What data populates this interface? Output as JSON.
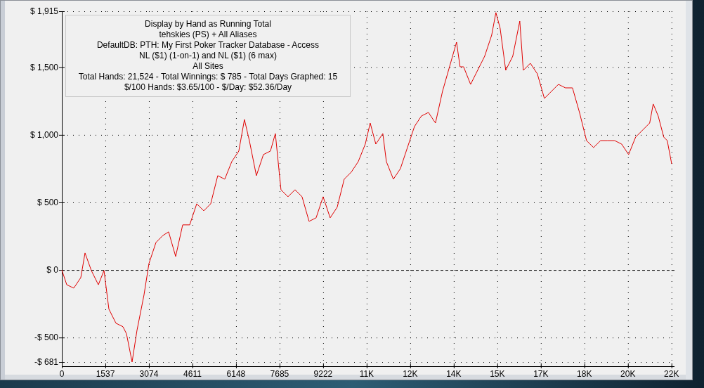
{
  "graph": {
    "legend_lines": [
      "Display by Hand as Running Total",
      "tehskies (PS) + All Aliases",
      "DefaultDB: PTH: My First Poker Tracker Database - Access",
      "NL ($1) (1-on-1) and NL ($1) (6 max)",
      "All Sites",
      "Total Hands: 21,524 - Total Winnings: $ 785 - Total Days Graphed: 15",
      "$/100 Hands: $3.65/100 - $/Day: $52.36/Day"
    ],
    "chart_data": {
      "type": "line",
      "x": [
        0,
        174,
        421,
        669,
        818,
        1041,
        1289,
        1487,
        1661,
        1909,
        2157,
        2281,
        2479,
        2653,
        2900,
        3074,
        3322,
        3570,
        3768,
        4016,
        4264,
        4512,
        4760,
        5008,
        5255,
        5503,
        5751,
        5999,
        6247,
        6445,
        6619,
        6867,
        7115,
        7363,
        7536,
        7734,
        7982,
        8230,
        8478,
        8726,
        8974,
        9222,
        9470,
        9718,
        9966,
        10213,
        10461,
        10709,
        10883,
        11081,
        11329,
        11453,
        11701,
        11949,
        12197,
        12445,
        12692,
        12940,
        13188,
        13436,
        13684,
        13932,
        14056,
        14180,
        14428,
        14676,
        14924,
        15171,
        15320,
        15469,
        15667,
        15915,
        16163,
        16287,
        16535,
        16783,
        17031,
        17279,
        17526,
        17774,
        18022,
        18270,
        18518,
        18766,
        19014,
        19262,
        19510,
        19758,
        20005,
        20253,
        20501,
        20749,
        20873,
        21047,
        21245,
        21369,
        21524
      ],
      "series": [
        {
          "color": "#e00000",
          "values": [
            0,
            -109,
            -134,
            -56,
            126,
            -4,
            -109,
            -4,
            -290,
            -394,
            -420,
            -472,
            -681,
            -446,
            -186,
            48,
            204,
            256,
            282,
            100,
            334,
            334,
            490,
            438,
            490,
            698,
            672,
            802,
            880,
            1114,
            958,
            698,
            854,
            880,
            1010,
            594,
            542,
            594,
            542,
            360,
            386,
            542,
            386,
            464,
            672,
            724,
            802,
            932,
            1088,
            932,
            1010,
            802,
            672,
            750,
            906,
            1062,
            1140,
            1166,
            1088,
            1322,
            1504,
            1686,
            1504,
            1504,
            1374,
            1478,
            1582,
            1738,
            1905,
            1790,
            1478,
            1582,
            1842,
            1478,
            1530,
            1452,
            1270,
            1322,
            1374,
            1348,
            1348,
            1166,
            958,
            906,
            958,
            958,
            958,
            932,
            854,
            984,
            1036,
            1088,
            1229,
            1140,
            984,
            958,
            785
          ]
        }
      ],
      "grid": true,
      "xlim": [
        0,
        21524
      ],
      "ylim": [
        -681,
        1915
      ],
      "xticks": [
        0,
        1537,
        3074,
        4611,
        6148,
        7685,
        9222,
        {
          "value": 10759,
          "label": "11K"
        },
        {
          "value": 12296,
          "label": "12K"
        },
        {
          "value": 13833,
          "label": "14K"
        },
        {
          "value": 15370,
          "label": "15K"
        },
        {
          "value": 16907,
          "label": "17K"
        },
        {
          "value": 18444,
          "label": "18K"
        },
        {
          "value": 19981,
          "label": "20K"
        },
        {
          "value": 21518,
          "label": "22K"
        }
      ],
      "yticks": [
        {
          "value": -681,
          "label": "-$ 681"
        },
        {
          "value": -500,
          "label": "-$ 500"
        },
        {
          "value": 0,
          "label": "$ 0"
        },
        {
          "value": 500,
          "label": "$ 500"
        },
        {
          "value": 1000,
          "label": "$ 1,000"
        },
        {
          "value": 1500,
          "label": "$ 1,500"
        },
        {
          "value": 1915,
          "label": "$ 1,915"
        }
      ]
    }
  }
}
